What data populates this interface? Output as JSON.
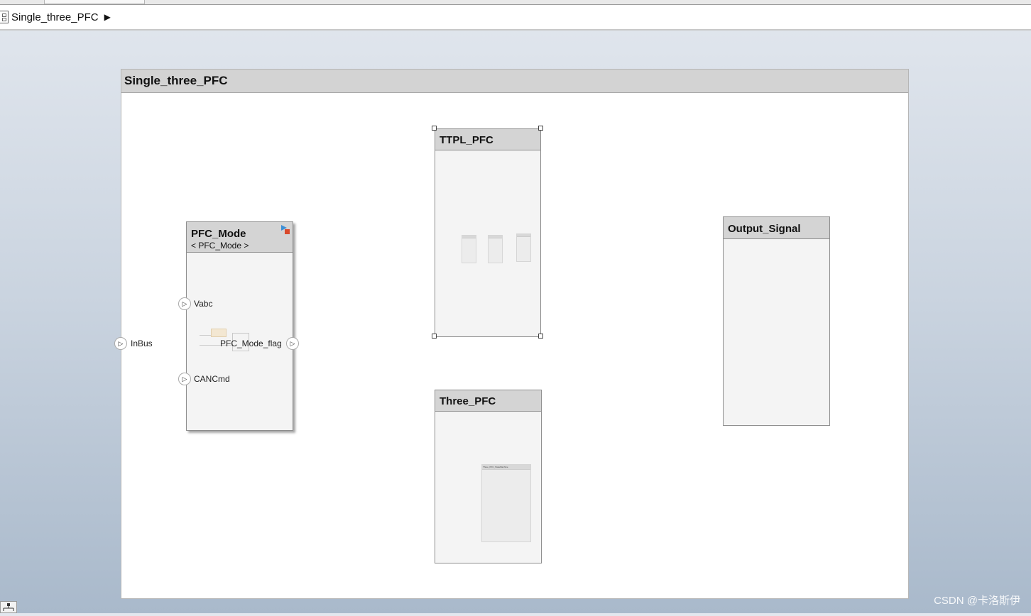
{
  "breadcrumb": {
    "model_name": "Single_three_PFC",
    "icon": "model-icon",
    "arrow": "▶"
  },
  "model": {
    "title": "Single_three_PFC"
  },
  "inport": {
    "label": "InBus",
    "icon": "inport-icon"
  },
  "blocks": {
    "pfc_mode": {
      "title": "PFC_Mode",
      "subtitle": "< PFC_Mode >",
      "badge_icon": "model-reference-icon",
      "inputs": [
        "Vabc",
        "CANCmd"
      ],
      "output": "PFC_Mode_flag"
    },
    "ttpl_pfc": {
      "title": "TTPL_PFC"
    },
    "three_pfc": {
      "title": "Three_PFC",
      "inner_title": "Three_PFC_StateMachine"
    },
    "output_signal": {
      "title": "Output_Signal"
    }
  },
  "watermark": "CSDN @卡洛斯伊"
}
